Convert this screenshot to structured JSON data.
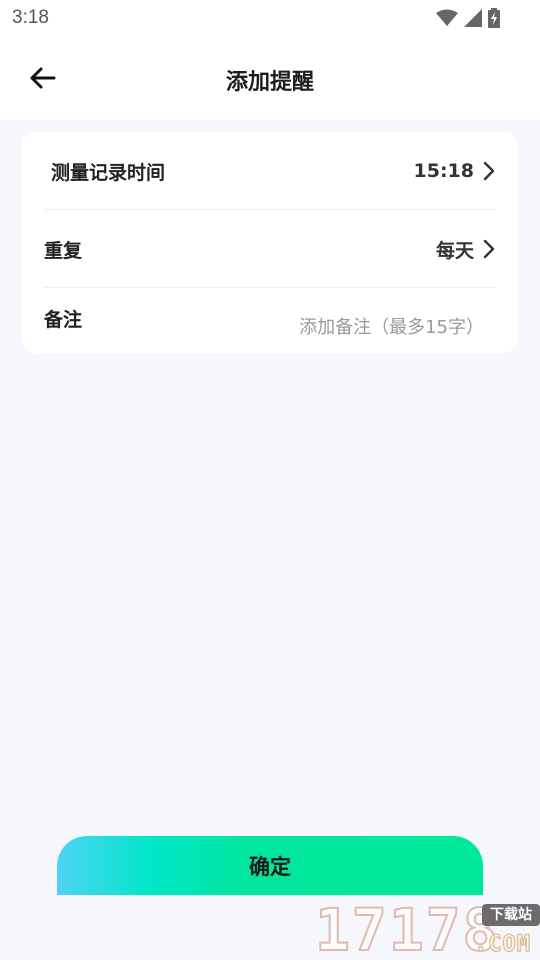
{
  "status_bar": {
    "time": "3:18",
    "icons": [
      "wifi-icon",
      "signal-icon",
      "battery-charging-icon"
    ]
  },
  "header": {
    "title": "添加提醒",
    "back_icon": "arrow-left-icon"
  },
  "form": {
    "measure_time": {
      "label": "测量记录时间",
      "value": "15:18"
    },
    "repeat": {
      "label": "重复",
      "value": "每天"
    },
    "note": {
      "label": "备注",
      "placeholder": "添加备注（最多15字）"
    }
  },
  "confirm": {
    "label": "确定"
  },
  "watermark": {
    "digits": "17178",
    "tag": "下载站",
    "domain": ".COM"
  },
  "colors": {
    "background": "#f6f7fc",
    "card": "#ffffff",
    "gradient_start": "#4fd3f5",
    "gradient_end": "#00e99a"
  }
}
